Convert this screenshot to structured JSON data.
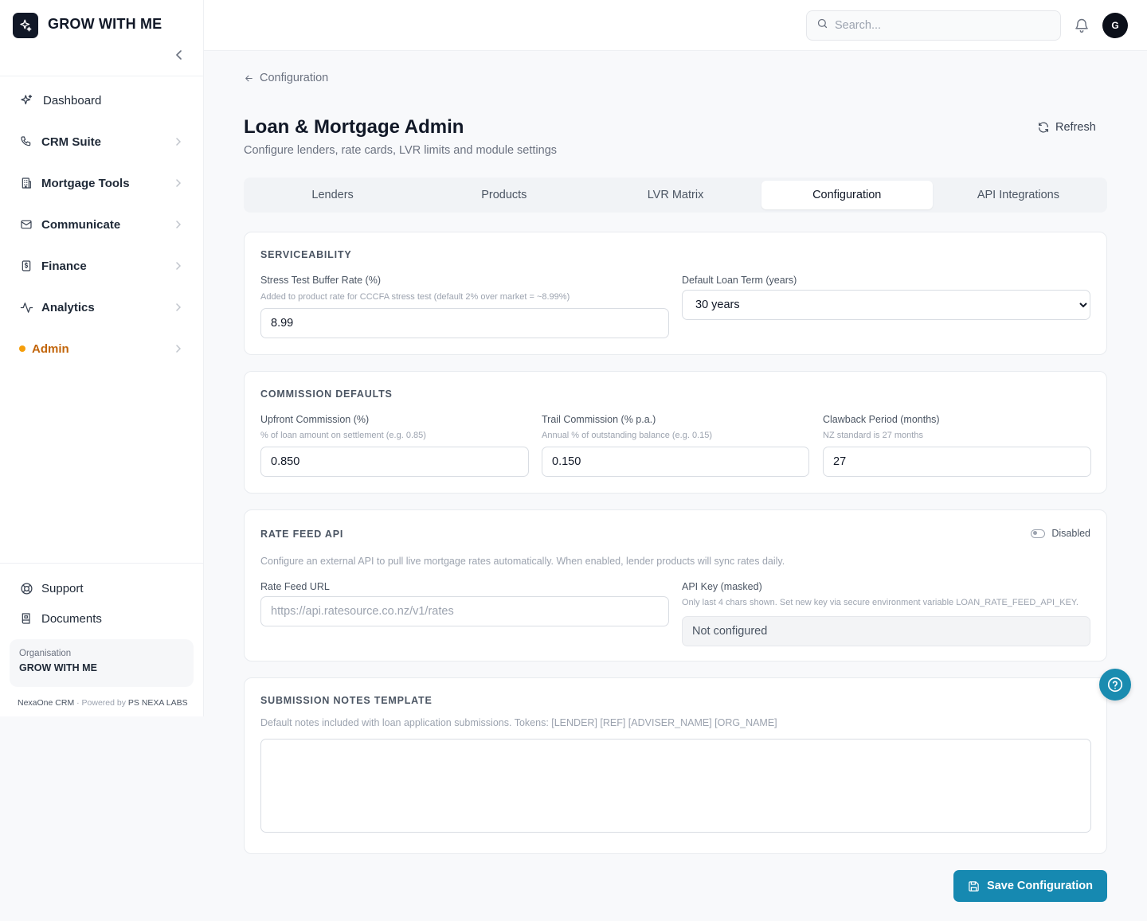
{
  "brand": {
    "name": "GROW WITH ME"
  },
  "sidebar": {
    "items": [
      {
        "label": "Dashboard",
        "icon": "sparkles-icon"
      },
      {
        "label": "CRM Suite",
        "icon": "phone-icon"
      },
      {
        "label": "Mortgage Tools",
        "icon": "building-icon"
      },
      {
        "label": "Communicate",
        "icon": "mail-icon"
      },
      {
        "label": "Finance",
        "icon": "dollar-icon"
      },
      {
        "label": "Analytics",
        "icon": "activity-icon"
      },
      {
        "label": "Admin",
        "icon": "dot",
        "active": true
      }
    ],
    "bottom": [
      {
        "label": "Support",
        "icon": "lifebuoy-icon"
      },
      {
        "label": "Documents",
        "icon": "book-icon"
      }
    ],
    "org": {
      "caption": "Organisation",
      "name": "GROW WITH ME"
    },
    "powered": {
      "product": "NexaOne CRM",
      "separator": "·",
      "text": "Powered by",
      "company": "PS NEXA LABS"
    }
  },
  "topbar": {
    "search_placeholder": "Search...",
    "avatar_initial": "G"
  },
  "page": {
    "back_label": "Configuration",
    "title": "Loan & Mortgage Admin",
    "subtitle": "Configure lenders, rate cards, LVR limits and module settings",
    "refresh_label": "Refresh"
  },
  "tabs": [
    {
      "label": "Lenders"
    },
    {
      "label": "Products"
    },
    {
      "label": "LVR Matrix"
    },
    {
      "label": "Configuration",
      "active": true
    },
    {
      "label": "API Integrations"
    }
  ],
  "serviceability": {
    "title": "SERVICEABILITY",
    "stress_label": "Stress Test Buffer Rate (%)",
    "stress_help": "Added to product rate for CCCFA stress test (default 2% over market = ~8.99%)",
    "stress_value": "8.99",
    "term_label": "Default Loan Term (years)",
    "term_value": "30 years"
  },
  "commission": {
    "title": "COMMISSION DEFAULTS",
    "upfront_label": "Upfront Commission (%)",
    "upfront_help": "% of loan amount on settlement (e.g. 0.85)",
    "upfront_value": "0.850",
    "trail_label": "Trail Commission (% p.a.)",
    "trail_help": "Annual % of outstanding balance (e.g. 0.15)",
    "trail_value": "0.150",
    "clawback_label": "Clawback Period (months)",
    "clawback_help": "NZ standard is 27 months",
    "clawback_value": "27"
  },
  "rate_feed": {
    "title": "RATE FEED API",
    "toggle_label": "Disabled",
    "description": "Configure an external API to pull live mortgage rates automatically. When enabled, lender products will sync rates daily.",
    "url_label": "Rate Feed URL",
    "url_placeholder": "https://api.ratesource.co.nz/v1/rates",
    "key_label": "API Key (masked)",
    "key_help": "Only last 4 chars shown. Set new key via secure environment variable LOAN_RATE_FEED_API_KEY.",
    "key_value": "Not configured"
  },
  "notes": {
    "title": "SUBMISSION NOTES TEMPLATE",
    "description": "Default notes included with loan application submissions. Tokens: [LENDER] [REF] [ADVISER_NAME] [ORG_NAME]",
    "value": ""
  },
  "actions": {
    "save_label": "Save Configuration"
  },
  "colors": {
    "accent": "#1689b1",
    "admin": "#c2650a",
    "admin_dot": "#f59e0b"
  }
}
